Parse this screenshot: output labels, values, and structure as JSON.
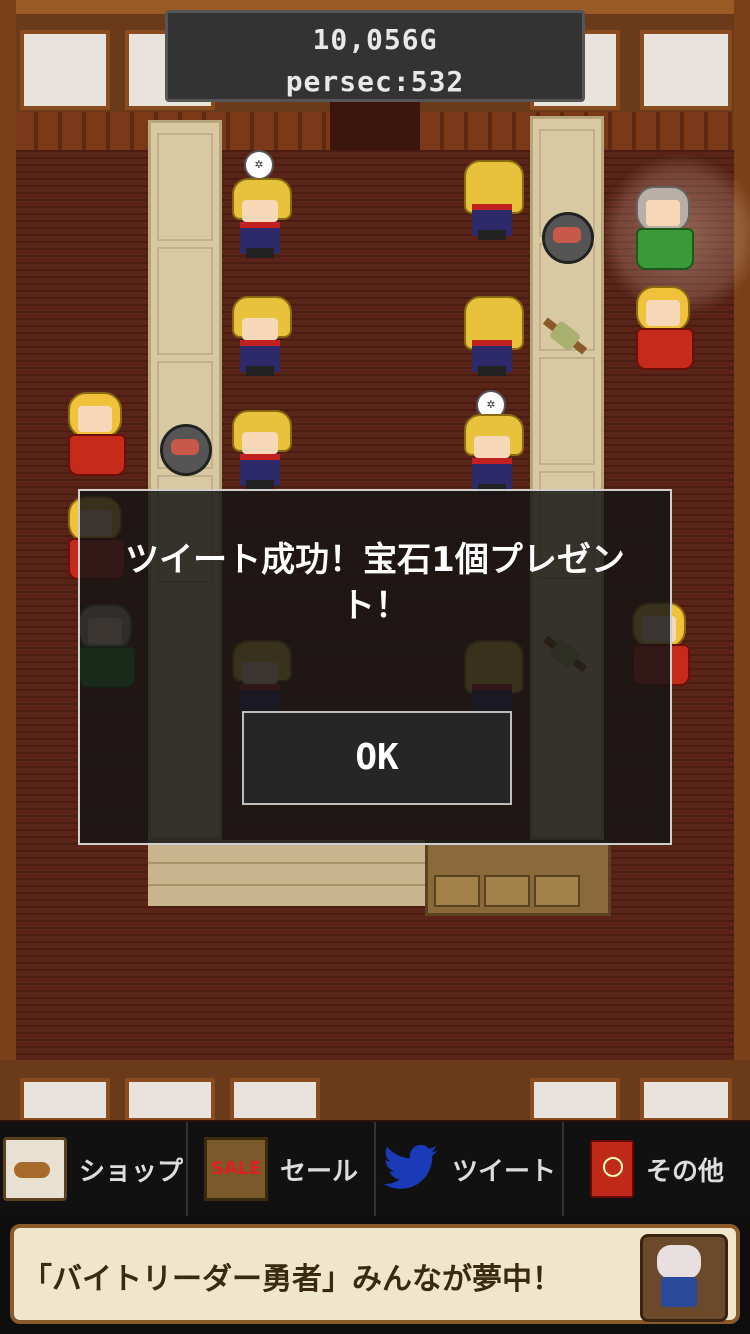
{
  "hud": {
    "gold": "10,056G",
    "persec": "persec:532"
  },
  "dialog": {
    "message": "ツイート成功！宝石1個プレゼント！",
    "ok_label": "OK"
  },
  "nav": {
    "items": [
      {
        "label": "ショップ",
        "icon": "shop-icon"
      },
      {
        "label": "セール",
        "icon": "sale-sign-icon",
        "badge": "SALE"
      },
      {
        "label": "ツイート",
        "icon": "twitter-bird-icon"
      },
      {
        "label": "その他",
        "icon": "book-icon"
      }
    ]
  },
  "banner": {
    "text": "「バイトリーダー勇者」みんなが夢中！"
  },
  "colors": {
    "floor": "#5a2418",
    "counter": "#d9c9a3",
    "dialog_bg": "#161616",
    "twitter_blue": "#1a3ab8"
  }
}
